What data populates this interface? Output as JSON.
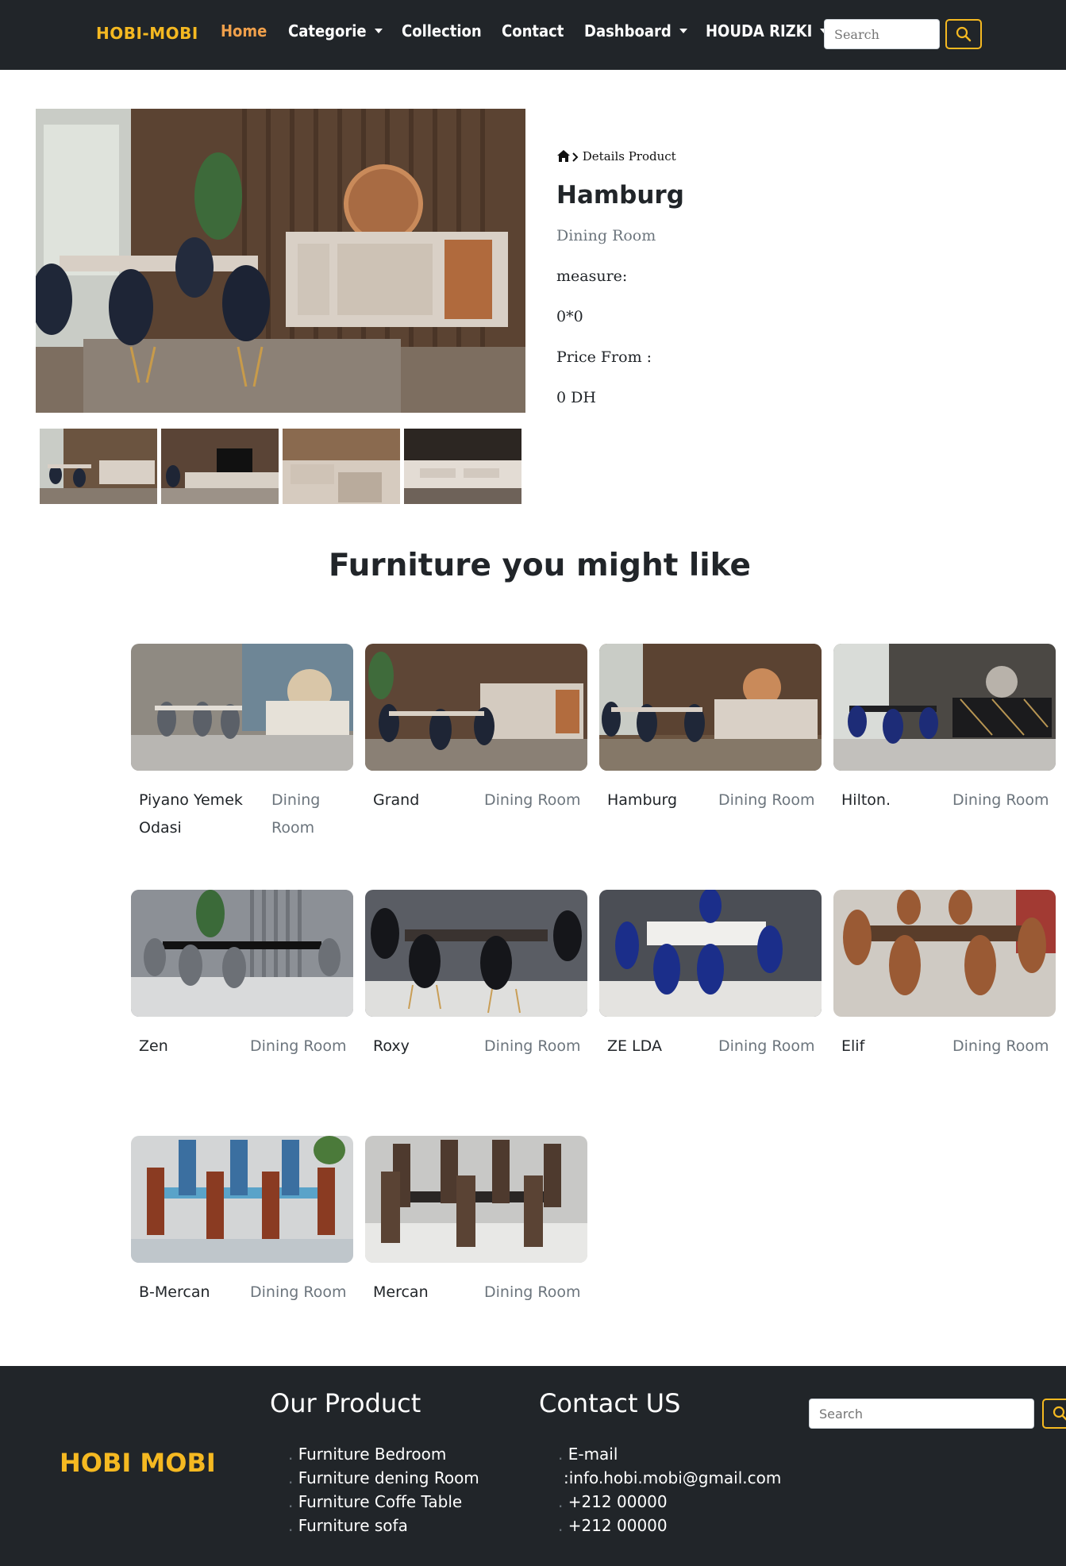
{
  "navbar": {
    "brand": "HOBI-MOBI",
    "items": [
      {
        "label": "Home"
      },
      {
        "label": "Categorie"
      },
      {
        "label": "Collection"
      },
      {
        "label": "Contact"
      },
      {
        "label": "Dashboard"
      },
      {
        "label": "HOUDA RIZKI"
      }
    ],
    "search_placeholder": "Search"
  },
  "product": {
    "breadcrumb": "Details Product",
    "title": "Hamburg",
    "category": "Dining Room",
    "measure_label": "measure:",
    "measure_value": "0*0",
    "price_label": "Price From :",
    "price_value": "0 DH"
  },
  "section_title": "Furniture you might like",
  "cards": [
    {
      "name": "Piyano Yemek Odasi",
      "category": "Dining Room"
    },
    {
      "name": "Grand",
      "category": "Dining Room"
    },
    {
      "name": "Hamburg",
      "category": "Dining Room"
    },
    {
      "name": "Hilton.",
      "category": "Dining Room"
    },
    {
      "name": "Zen",
      "category": "Dining Room"
    },
    {
      "name": "Roxy",
      "category": "Dining Room"
    },
    {
      "name": "ZE LDA",
      "category": "Dining Room"
    },
    {
      "name": "Elif",
      "category": "Dining Room"
    },
    {
      "name": "B-Mercan",
      "category": "Dining Room"
    },
    {
      "name": "Mercan",
      "category": "Dining Room"
    }
  ],
  "footer": {
    "brand": "HOBI MOBI",
    "product_heading": "Our Product",
    "products": [
      "Furniture Bedroom",
      "Furniture dening Room",
      "Furniture Coffe Table",
      "Furniture sofa"
    ],
    "contact_heading": "Contact US",
    "contacts": [
      "E-mail",
      ":info.hobi.mobi@gmail.com",
      "+212 00000",
      "+212 00000"
    ],
    "search_placeholder": "Search"
  },
  "colors": {
    "navbar_bg": "#212529",
    "brand_gold": "#f5b921",
    "active_link": "#f0a04b",
    "muted_text": "#6c757d"
  }
}
